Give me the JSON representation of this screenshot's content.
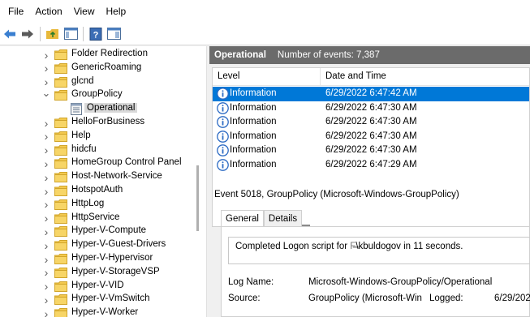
{
  "menu": [
    "File",
    "Action",
    "View",
    "Help"
  ],
  "tree": {
    "items": [
      {
        "label": "Folder Redirection",
        "expanded": false
      },
      {
        "label": "GenericRoaming",
        "expanded": false
      },
      {
        "label": "glcnd",
        "expanded": false
      },
      {
        "label": "GroupPolicy",
        "expanded": true
      },
      {
        "label": "Operational",
        "child": true,
        "selected": true
      },
      {
        "label": "HelloForBusiness",
        "expanded": false
      },
      {
        "label": "Help",
        "expanded": false
      },
      {
        "label": "hidcfu",
        "expanded": false
      },
      {
        "label": "HomeGroup Control Panel",
        "expanded": false
      },
      {
        "label": "Host-Network-Service",
        "expanded": false
      },
      {
        "label": "HotspotAuth",
        "expanded": false
      },
      {
        "label": "HttpLog",
        "expanded": false
      },
      {
        "label": "HttpService",
        "expanded": false
      },
      {
        "label": "Hyper-V-Compute",
        "expanded": false
      },
      {
        "label": "Hyper-V-Guest-Drivers",
        "expanded": false
      },
      {
        "label": "Hyper-V-Hypervisor",
        "expanded": false
      },
      {
        "label": "Hyper-V-StorageVSP",
        "expanded": false
      },
      {
        "label": "Hyper-V-VID",
        "expanded": false
      },
      {
        "label": "Hyper-V-VmSwitch",
        "expanded": false
      },
      {
        "label": "Hyper-V-Worker",
        "expanded": false
      }
    ]
  },
  "pane": {
    "title": "Operational",
    "count": "Number of events: 7,387"
  },
  "grid": {
    "columns": [
      "Level",
      "Date and Time"
    ],
    "rows": [
      {
        "level": "Information",
        "datetime": "6/29/2022 6:47:42 AM",
        "selected": true
      },
      {
        "level": "Information",
        "datetime": "6/29/2022 6:47:30 AM"
      },
      {
        "level": "Information",
        "datetime": "6/29/2022 6:47:30 AM"
      },
      {
        "level": "Information",
        "datetime": "6/29/2022 6:47:30 AM"
      },
      {
        "level": "Information",
        "datetime": "6/29/2022 6:47:30 AM"
      },
      {
        "level": "Information",
        "datetime": "6/29/2022 6:47:29 AM"
      }
    ]
  },
  "detail": {
    "title": "Event 5018, GroupPolicy (Microsoft-Windows-GroupPolicy)",
    "tabs": [
      "General",
      "Details"
    ],
    "message_prefix": "Completed Logon script for ",
    "message_redacted": "F̶̶̶̶̶̶̶",
    "message_suffix": "\\kbuldogov in 11 seconds.",
    "log_name_label": "Log Name:",
    "log_name_value": "Microsoft-Windows-GroupPolicy/Operational",
    "source_label": "Source:",
    "source_value": "GroupPolicy (Microsoft-Win",
    "logged_label": "Logged:",
    "logged_value": "6/29/202"
  },
  "colors": {
    "selection": "#0078d7",
    "titlebar": "#6b6b6b",
    "folder": "#f3c94f"
  }
}
